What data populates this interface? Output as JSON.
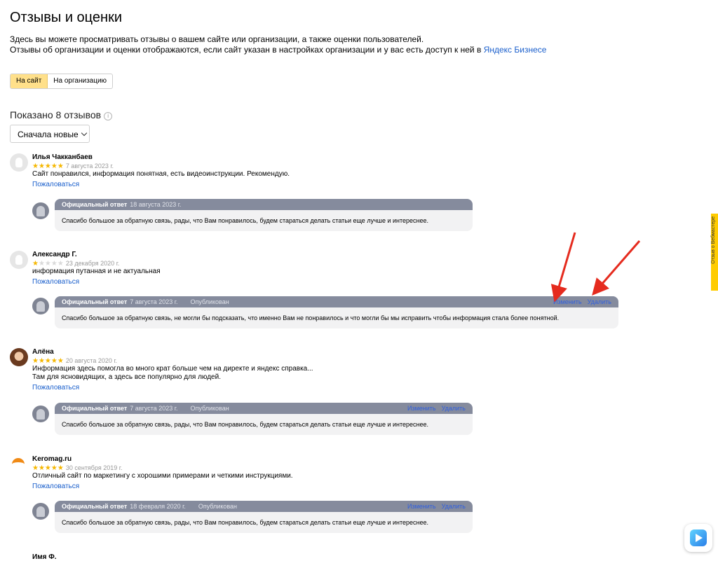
{
  "header": {
    "title": "Отзывы и оценки",
    "desc_line1": "Здесь вы можете просматривать отзывы о вашем сайте или организации, а также оценки пользователей.",
    "desc_line2": "Отзывы об организации и оценки отображаются, если сайт указан в настройках организации и у вас есть доступ к ней в",
    "desc_link": "Яндекс Бизнесе"
  },
  "switcher": {
    "site": "На сайт",
    "org": "На организацию"
  },
  "count_text": "Показано 8 отзывов",
  "info_icon": "i",
  "sort_label": "Сначала новые",
  "complain_label": "Пожаловаться",
  "answer_label": "Официальный ответ",
  "edit_label": "Изменить",
  "delete_label": "Удалить",
  "colors": {
    "accent": "#ffcc00",
    "link": "#1a5fcc",
    "answer_header": "#858b9d",
    "arrow": "#e52b1e"
  },
  "reviews": [
    {
      "author": "Илья Чакканбаев",
      "stars": "★★★★★",
      "stars_off": "",
      "date": "7 августа 2023 г.",
      "text": "Сайт понравился, информация понятная, есть видеоинструкции. Рекомендую.",
      "text2": "",
      "answer": {
        "date": "18 августа 2023 г.",
        "status": "",
        "edit": "",
        "delete": "",
        "text": "Спасибо большое за обратную связь, рады, что Вам понравилось, будем стараться делать статьи еще лучше и интереснее."
      }
    },
    {
      "author": "Александр Г.",
      "stars": "★",
      "stars_off": "★★★★",
      "date": "23 декабря 2020 г.",
      "text": "информация путанная и не актуальная",
      "text2": "",
      "answer": {
        "date": "7 августа 2023 г.",
        "status": "Опубликован",
        "edit": "Изменить",
        "delete": "Удалить",
        "text": "Спасибо большое за обратную связь, не могли бы подсказать, что именно Вам не понравилось и что могли бы мы исправить чтобы информация стала более понятной."
      }
    },
    {
      "author": "Алёна",
      "stars": "★★★★★",
      "stars_off": "",
      "date": "20 августа 2020 г.",
      "text": "Информация здесь помогла во много крат больше чем на директе и яндекс справка...",
      "text2": "Там для ясновидящих, а здесь все популярно для людей.",
      "answer": {
        "date": "7 августа 2023 г.",
        "status": "Опубликован",
        "edit": "Изменить",
        "delete": "Удалить",
        "text": "Спасибо большое за обратную связь, рады, что Вам понравилось, будем стараться делать статьи еще лучше и интереснее."
      }
    },
    {
      "author": "Keromag.ru",
      "stars": "★★★★★",
      "stars_off": "",
      "date": "30 сентября 2019 г.",
      "text": "Отличный сайт по маркетингу с хорошими примерами и четкими инструкциями.",
      "text2": "",
      "answer": {
        "date": "18 февраля 2020 г.",
        "status": "Опубликован",
        "edit": "Изменить",
        "delete": "Удалить",
        "text": "Спасибо большое за обратную связь, рады, что Вам понравилось, будем стараться делать статьи еще лучше и интереснее."
      }
    },
    {
      "author": "Имя Ф."
    }
  ],
  "side_tab": "Отзыв о Вебмастере"
}
